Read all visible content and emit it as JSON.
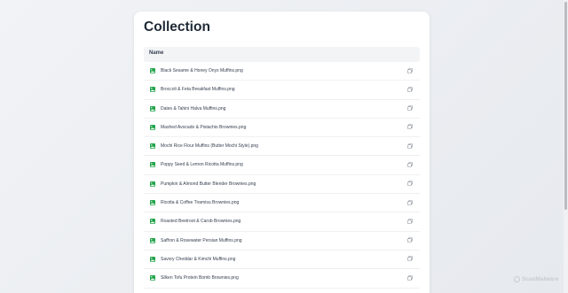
{
  "page": {
    "title": "Collection"
  },
  "table": {
    "header": "Name",
    "rows": [
      "Black Sesame & Honey Onyx Muffins.png",
      "Broccoli & Feta Breakfast Muffins.png",
      "Dates & Tahini Halva Muffins.png",
      "Mashed Avocado & Pistachio Brownies.png",
      "Mochi Rice Flour Muffins (Butter Mochi Style).png",
      "Poppy Seed & Lemon Ricotta Muffins.png",
      "Pumpkin & Almond Butter Blender Brownies.png",
      "Ricotta & Coffee Tiramisu Brownies.png",
      "Roasted Beetroot & Carob Brownies.png",
      "Saffron & Rosewater Persian Muffins.png",
      "Savory Cheddar & Kimchi Muffins.png",
      "Silken Tofu Protein Bomb Brownies.png"
    ]
  },
  "icons": {
    "file": "image-file-icon",
    "action": "copy-icon"
  },
  "colors": {
    "file_icon": "#22a34a",
    "title": "#1f2a37"
  },
  "watermark": {
    "text": "ScanMalware"
  }
}
